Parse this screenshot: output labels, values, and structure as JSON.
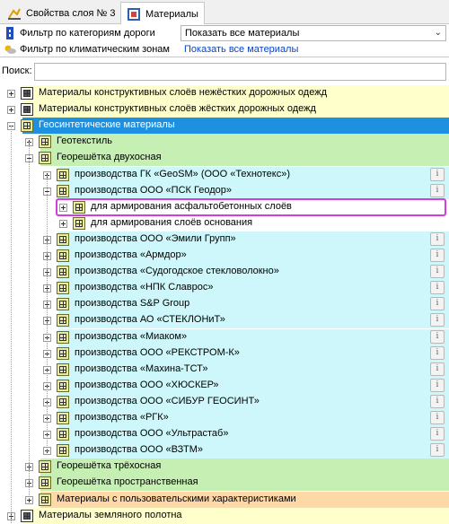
{
  "tabs": [
    {
      "label": "Свойства слоя № 3",
      "icon": "layer-properties-icon"
    },
    {
      "label": "Материалы",
      "icon": "materials-icon"
    }
  ],
  "filters": {
    "road_category": {
      "label": "Фильтр по категориям дороги",
      "value": "Показать все материалы",
      "icon": "road-category-icon"
    },
    "climate_zone": {
      "label": "Фильтр по климатическим зонам",
      "value": "Показать все материалы",
      "icon": "climate-zone-icon"
    }
  },
  "search": {
    "label": "Поиск:",
    "value": ""
  },
  "colors": {
    "yellow": "#ffffcc",
    "green": "#c6efb3",
    "cyan": "#cdf7fa",
    "blue_selected": "#1e90e0",
    "orange": "#ffd8a8",
    "selection_outline": "#d43dd8"
  },
  "tree": [
    {
      "label": "Материалы конструктивных слоёв нежёстких дорожных одежд",
      "expanded": false,
      "has_info": false
    },
    {
      "label": "Материалы конструктивных слоёв жёстких дорожных одежд",
      "expanded": false,
      "has_info": false
    },
    {
      "label": "Геосинтетические материалы",
      "expanded": true,
      "selected": true,
      "has_info": false
    },
    {
      "label": "Геотекстиль",
      "expanded": false,
      "has_info": false
    },
    {
      "label": "Георешётка двухосная",
      "expanded": true,
      "has_info": false
    },
    {
      "label": "производства ГК «GeoSM» (ООО «Технотекс»)",
      "expanded": false,
      "has_info": true
    },
    {
      "label": "производства ООО «ПСК Геодор»",
      "expanded": true,
      "has_info": true
    },
    {
      "label": "для армирования асфальтобетонных слоёв",
      "expanded": false,
      "has_info": false,
      "highlighted": true
    },
    {
      "label": "для армирования слоёв основания",
      "expanded": false,
      "has_info": false
    },
    {
      "label": "производства ООО «Эмили Групп»",
      "expanded": false,
      "has_info": true
    },
    {
      "label": "производства «Армдор»",
      "expanded": false,
      "has_info": true
    },
    {
      "label": "производства «Судогодское стекловолокно»",
      "expanded": false,
      "has_info": true
    },
    {
      "label": "производства «НПК Славрос»",
      "expanded": false,
      "has_info": true
    },
    {
      "label": "производства S&P Group",
      "expanded": false,
      "has_info": true
    },
    {
      "label": "производства АО «СТЕКЛОНиТ»",
      "expanded": false,
      "has_info": true
    },
    {
      "label": "производства «Миаком»",
      "expanded": false,
      "has_info": true
    },
    {
      "label": "производства ООО «РЕКСТРОМ-К»",
      "expanded": false,
      "has_info": true
    },
    {
      "label": "производства «Махина-ТСТ»",
      "expanded": false,
      "has_info": true
    },
    {
      "label": "производства ООО «ХЮСКЕР»",
      "expanded": false,
      "has_info": true
    },
    {
      "label": "производства ООО «СИБУР ГЕОСИНТ»",
      "expanded": false,
      "has_info": true
    },
    {
      "label": "производства «РГК»",
      "expanded": false,
      "has_info": true
    },
    {
      "label": "производства ООО «Ультрастаб»",
      "expanded": false,
      "has_info": true
    },
    {
      "label": "производства ООО «ВЗТМ»",
      "expanded": false,
      "has_info": true
    },
    {
      "label": "Георешётка трёхосная",
      "expanded": false,
      "has_info": false
    },
    {
      "label": "Георешётка пространственная",
      "expanded": false,
      "has_info": false
    },
    {
      "label": "Материалы с пользовательскими характеристиками",
      "expanded": false,
      "has_info": false
    },
    {
      "label": "Материалы земляного полотна",
      "expanded": false,
      "has_info": false
    }
  ],
  "info_glyph": "i"
}
